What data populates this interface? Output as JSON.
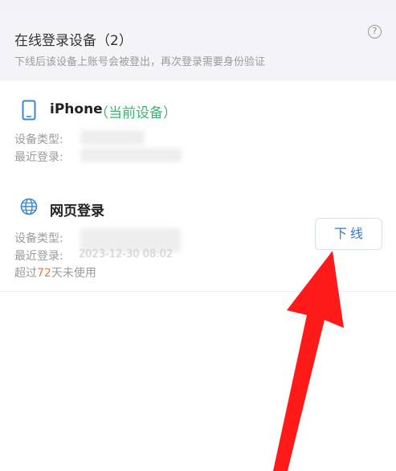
{
  "header": {
    "title": "在线登录设备（2）",
    "subtitle": "下线后该设备上账号会被登出，再次登录需要身份验证",
    "help_icon": "question-circle-icon"
  },
  "devices": [
    {
      "icon": "phone-icon",
      "name": "iPhone",
      "tag": "（当前设备）",
      "type_label": "设备类型:",
      "last_login_label": "最近登录:"
    },
    {
      "icon": "globe-icon",
      "name": "网页登录",
      "type_label": "设备类型:",
      "last_login_label": "最近登录:",
      "last_login_value": "2023-12-30 08:02",
      "unused_prefix": "超过",
      "unused_days": "72",
      "unused_suffix": "天未使用",
      "logout_label": "下线"
    }
  ],
  "colors": {
    "accent_green": "#3cb371",
    "accent_orange": "#e8793f",
    "button_blue": "#3a78c4",
    "annotation_red": "#ff1a1a"
  }
}
